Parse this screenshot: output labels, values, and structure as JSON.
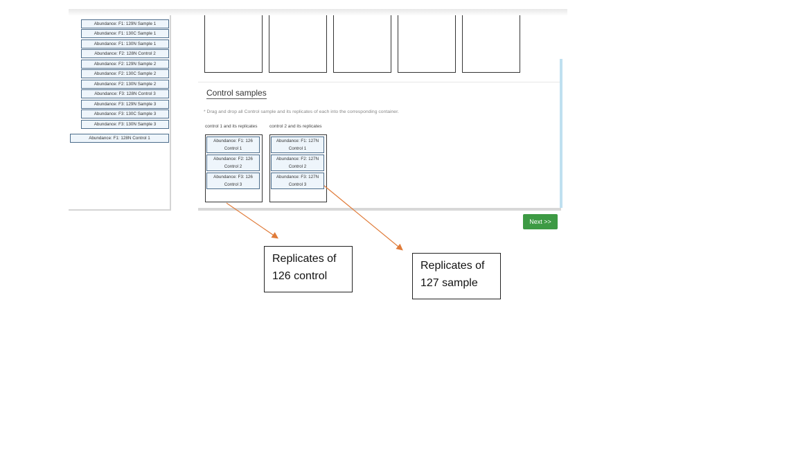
{
  "sidebar": {
    "items": [
      "Abundance: F1: 129N Sample 1",
      "Abundance: F1: 130C Sample 1",
      "Abundance: F1: 130N Sample 1",
      "Abundance: F2: 128N Control 2",
      "Abundance: F2: 129N Sample 2",
      "Abundance: F2: 130C Sample 2",
      "Abundance: F2: 130N Sample 2",
      "Abundance: F3: 128N Control 3",
      "Abundance: F3: 129N Sample 3",
      "Abundance: F3: 130C Sample 3",
      "Abundance: F3: 130N Sample 3"
    ],
    "extra_item": "Abundance: F1: 128N Control 1"
  },
  "control_section": {
    "title": "Control samples",
    "instruction": "* Drag and drop all Control sample and its replicates of each into the corresponding container.",
    "columns": [
      {
        "label": "control 1 and its replicates",
        "items": [
          "Abundance: F1: 126 Control 1",
          "Abundance: F2: 126 Control 2",
          "Abundance: F3: 126 Control 3"
        ]
      },
      {
        "label": "control 2 and its replicates",
        "items": [
          "Abundance: F1: 127N Control 1",
          "Abundance: F2: 127N Control 2",
          "Abundance: F3: 127N Control 3"
        ]
      }
    ]
  },
  "next_button": "Next >>",
  "callouts": {
    "left": [
      "Replicates of",
      "126 control"
    ],
    "right": [
      "Replicates of",
      "127 sample"
    ]
  },
  "colors": {
    "chip_bg": "#eef5fb",
    "chip_border": "#4a6b8a",
    "next_button": "#3d9a44",
    "arrow": "#e07b39"
  }
}
